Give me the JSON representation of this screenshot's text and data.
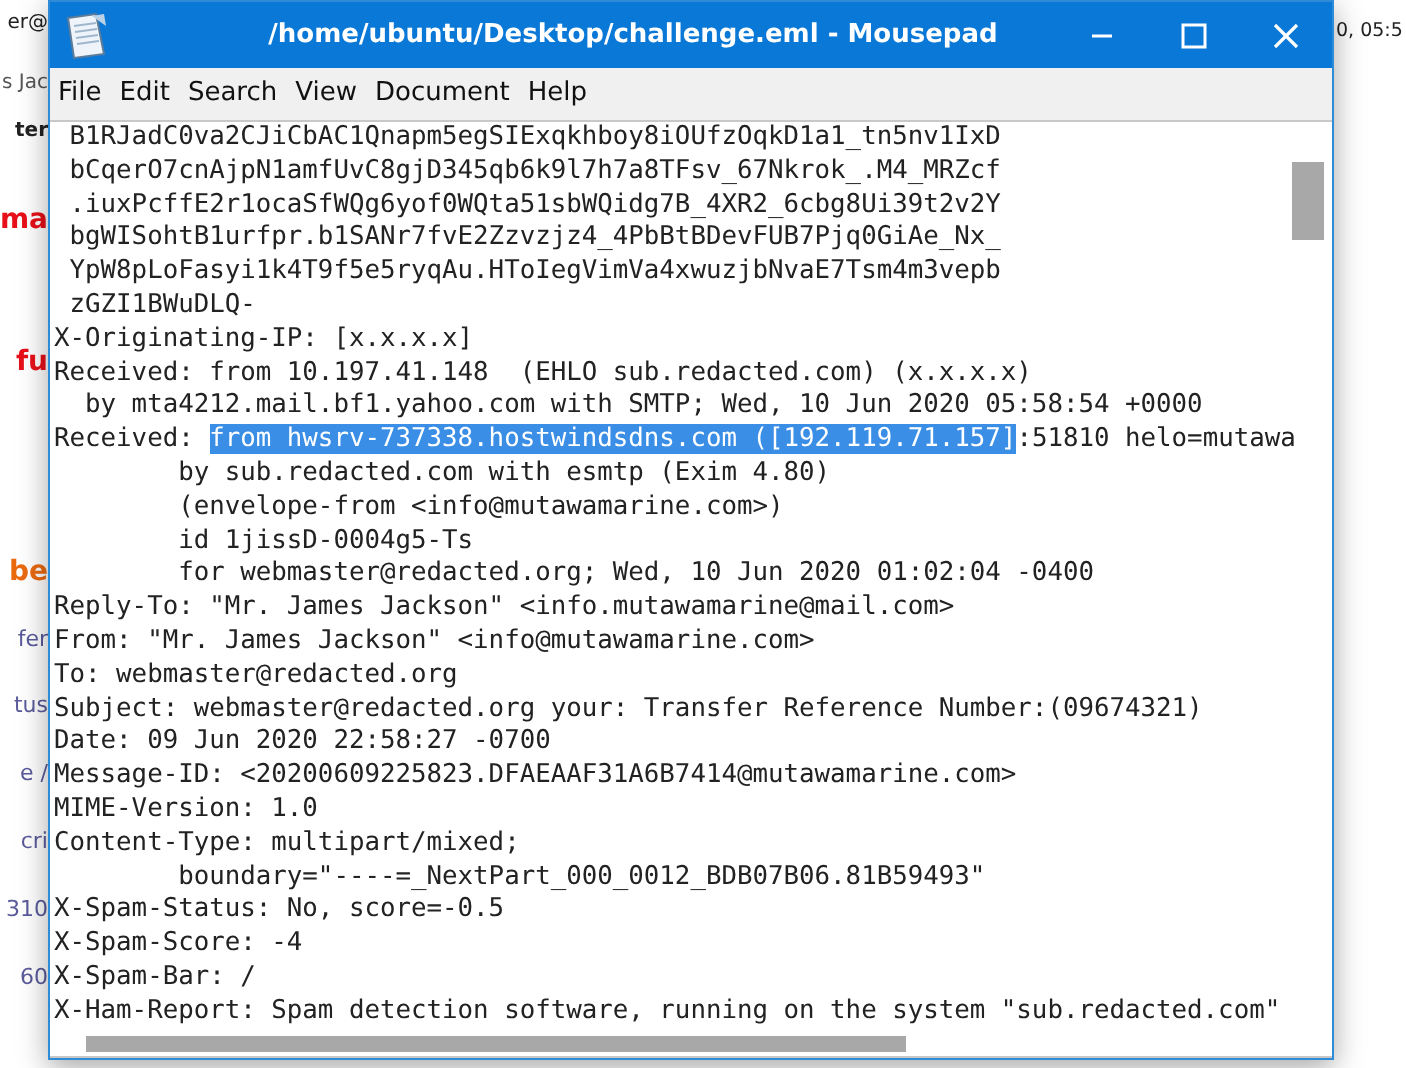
{
  "background_app": {
    "fragments": [
      {
        "text": "er@",
        "kind": "plain"
      },
      {
        "text": "s Jac",
        "kind": "muted"
      },
      {
        "text": "ter",
        "kind": "bold"
      },
      {
        "text": "ma",
        "kind": "alert"
      },
      {
        "text": "fu",
        "kind": "alert"
      },
      {
        "text": "be",
        "kind": "warning"
      },
      {
        "text": "fer",
        "kind": "link"
      },
      {
        "text": "tus",
        "kind": "link"
      },
      {
        "text": "e /",
        "kind": "link"
      },
      {
        "text": "cri",
        "kind": "link"
      },
      {
        "text": "310",
        "kind": "link"
      },
      {
        "text": "60",
        "kind": "link"
      }
    ],
    "top_right_text": "0, 05:5"
  },
  "window": {
    "title": "/home/ubuntu/Desktop/challenge.eml - Mousepad"
  },
  "menu": [
    "File",
    "Edit",
    "Search",
    "View",
    "Document",
    "Help"
  ],
  "editor": {
    "lines": [
      {
        "segments": [
          {
            "text": " B1RJadC0va2CJiCbAC1Qnapm5egSIExqkhboy8iOUfzOqkD1a1_tn5nv1IxD",
            "selected": false
          }
        ]
      },
      {
        "segments": [
          {
            "text": " bCqerO7cnAjpN1amfUvC8gjD345qb6k9l7h7a8TFsv_67Nkrok_.M4_MRZcf",
            "selected": false
          }
        ]
      },
      {
        "segments": [
          {
            "text": " .iuxPcffE2r1ocaSfWQg6yof0WQta51sbWQidg7B_4XR2_6cbg8Ui39t2v2Y",
            "selected": false
          }
        ]
      },
      {
        "segments": [
          {
            "text": " bgWISohtB1urfpr.b1SANr7fvE2Zzvzjz4_4PbBtBDevFUB7Pjq0GiAe_Nx_",
            "selected": false
          }
        ]
      },
      {
        "segments": [
          {
            "text": " YpW8pLoFasyi1k4T9f5e5ryqAu.HToIegVimVa4xwuzjbNvaE7Tsm4m3vepb",
            "selected": false
          }
        ]
      },
      {
        "segments": [
          {
            "text": " zGZI1BWuDLQ-",
            "selected": false
          }
        ]
      },
      {
        "segments": [
          {
            "text": "X-Originating-IP: [x.x.x.x]",
            "selected": false
          }
        ]
      },
      {
        "segments": [
          {
            "text": "Received: from 10.197.41.148  (EHLO sub.redacted.com) (x.x.x.x)",
            "selected": false
          }
        ]
      },
      {
        "segments": [
          {
            "text": "  by mta4212.mail.bf1.yahoo.com with SMTP; Wed, 10 Jun 2020 05:58:54 +0000",
            "selected": false
          }
        ]
      },
      {
        "segments": [
          {
            "text": "Received: ",
            "selected": false
          },
          {
            "text": "from hwsrv-737338.hostwindsdns.com ([192.119.71.157]",
            "selected": true
          },
          {
            "text": ":51810 helo=mutawa",
            "selected": false
          }
        ]
      },
      {
        "segments": [
          {
            "text": "        by sub.redacted.com with esmtp (Exim 4.80)",
            "selected": false
          }
        ]
      },
      {
        "segments": [
          {
            "text": "        (envelope-from <info@mutawamarine.com>)",
            "selected": false
          }
        ]
      },
      {
        "segments": [
          {
            "text": "        id 1jissD-0004g5-Ts",
            "selected": false
          }
        ]
      },
      {
        "segments": [
          {
            "text": "        for webmaster@redacted.org; Wed, 10 Jun 2020 01:02:04 -0400",
            "selected": false
          }
        ]
      },
      {
        "segments": [
          {
            "text": "Reply-To: \"Mr. James Jackson\" <info.mutawamarine@mail.com>",
            "selected": false
          }
        ]
      },
      {
        "segments": [
          {
            "text": "From: \"Mr. James Jackson\" <info@mutawamarine.com>",
            "selected": false
          }
        ]
      },
      {
        "segments": [
          {
            "text": "To: webmaster@redacted.org",
            "selected": false
          }
        ]
      },
      {
        "segments": [
          {
            "text": "Subject: webmaster@redacted.org your: Transfer Reference Number:(09674321)",
            "selected": false
          }
        ]
      },
      {
        "segments": [
          {
            "text": "Date: 09 Jun 2020 22:58:27 -0700",
            "selected": false
          }
        ]
      },
      {
        "segments": [
          {
            "text": "Message-ID: <20200609225823.DFAEAAF31A6B7414@mutawamarine.com>",
            "selected": false
          }
        ]
      },
      {
        "segments": [
          {
            "text": "MIME-Version: 1.0",
            "selected": false
          }
        ]
      },
      {
        "segments": [
          {
            "text": "Content-Type: multipart/mixed;",
            "selected": false
          }
        ]
      },
      {
        "segments": [
          {
            "text": "        boundary=\"----=_NextPart_000_0012_BDB07B06.81B59493\"",
            "selected": false
          }
        ]
      },
      {
        "segments": [
          {
            "text": "X-Spam-Status: No, score=-0.5",
            "selected": false
          }
        ]
      },
      {
        "segments": [
          {
            "text": "X-Spam-Score: -4",
            "selected": false
          }
        ]
      },
      {
        "segments": [
          {
            "text": "X-Spam-Bar: /",
            "selected": false
          }
        ]
      },
      {
        "segments": [
          {
            "text": "X-Ham-Report: Spam detection software, running on the system \"sub.redacted.com\"",
            "selected": false
          }
        ]
      }
    ]
  }
}
